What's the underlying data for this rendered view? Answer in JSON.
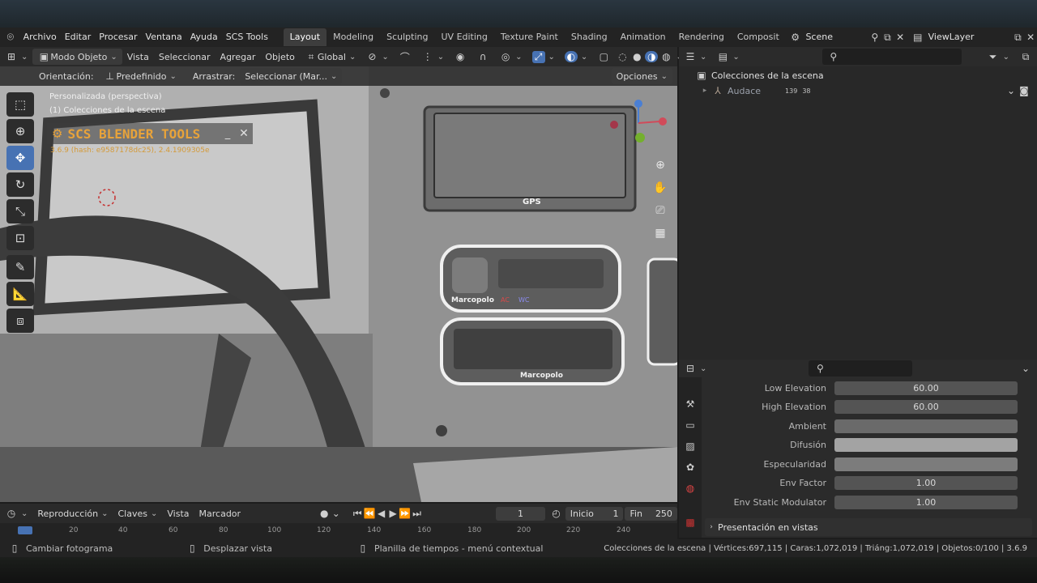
{
  "topmenu": {
    "items": [
      "Archivo",
      "Editar",
      "Procesar",
      "Ventana",
      "Ayuda",
      "SCS Tools"
    ],
    "workspaces": [
      "Layout",
      "Modeling",
      "Sculpting",
      "UV Editing",
      "Texture Paint",
      "Shading",
      "Animation",
      "Rendering",
      "Composit"
    ],
    "active_workspace": "Layout",
    "scene": "Scene",
    "viewlayer": "ViewLayer"
  },
  "viewport_header": {
    "mode": "Modo Objeto",
    "menus": [
      "Vista",
      "Seleccionar",
      "Agregar",
      "Objeto"
    ],
    "transform": "Global"
  },
  "tool_header": {
    "orientation_label": "Orientación:",
    "orientation_value": "Predefinido",
    "drag_label": "Arrastrar:",
    "drag_value": "Seleccionar (Mar...",
    "options": "Opciones"
  },
  "viewport": {
    "view_name": "Personalizada (perspectiva)",
    "collection": "(1) Colecciones de la escena",
    "addon_title": "SCS BLENDER TOOLS",
    "addon_version": "3.6.9 (hash: e9587178dc25), 2.4.1909305e",
    "gps_label": "GPS",
    "panel_brand_1": "Marcopolo",
    "panel_brand_2": "Marcopolo",
    "ac_label": "AC",
    "wc_label": "WC"
  },
  "outliner": {
    "root": "Colecciones de la escena",
    "child": "Audace",
    "count_1": "139",
    "count_2": "38"
  },
  "properties": {
    "rows": [
      {
        "label": "Low Elevation",
        "value": "60.00"
      },
      {
        "label": "High Elevation",
        "value": "60.00"
      },
      {
        "label": "Ambient",
        "value": ""
      },
      {
        "label": "Difusión",
        "value": ""
      },
      {
        "label": "Especularidad",
        "value": ""
      },
      {
        "label": "Env Factor",
        "value": "1.00"
      },
      {
        "label": "Env Static Modulator",
        "value": "1.00"
      }
    ],
    "section": "Presentación en vistas"
  },
  "timeline": {
    "menus": [
      "Reproducción",
      "Claves",
      "Vista",
      "Marcador"
    ],
    "current_frame": "1",
    "start_label": "Inicio",
    "start_value": "1",
    "end_label": "Fin",
    "end_value": "250",
    "ruler": [
      "0",
      "20",
      "40",
      "60",
      "80",
      "100",
      "120",
      "140",
      "160",
      "180",
      "200",
      "220",
      "240"
    ]
  },
  "statusbar": {
    "hint1": "Cambiar fotograma",
    "hint2": "Desplazar vista",
    "hint3": "Planilla de tiempos - menú contextual",
    "stats": "Colecciones de la escena | Vértices:697,115 | Caras:1,072,019 | Triáng:1,072,019 | Objetos:0/100 | 3.6.9"
  },
  "colors": {
    "accent": "#4772b3",
    "addon_title": "#e8a33a"
  },
  "icons": [
    "blender-logo",
    "select-box-icon",
    "cursor-icon",
    "move-icon",
    "rotate-icon",
    "scale-icon",
    "transform-icon",
    "annotate-icon",
    "measure-icon",
    "add-cube-icon",
    "zoom-icon",
    "hand-icon",
    "camera-icon",
    "grid-icon",
    "search-icon",
    "filter-icon",
    "play-icon"
  ]
}
